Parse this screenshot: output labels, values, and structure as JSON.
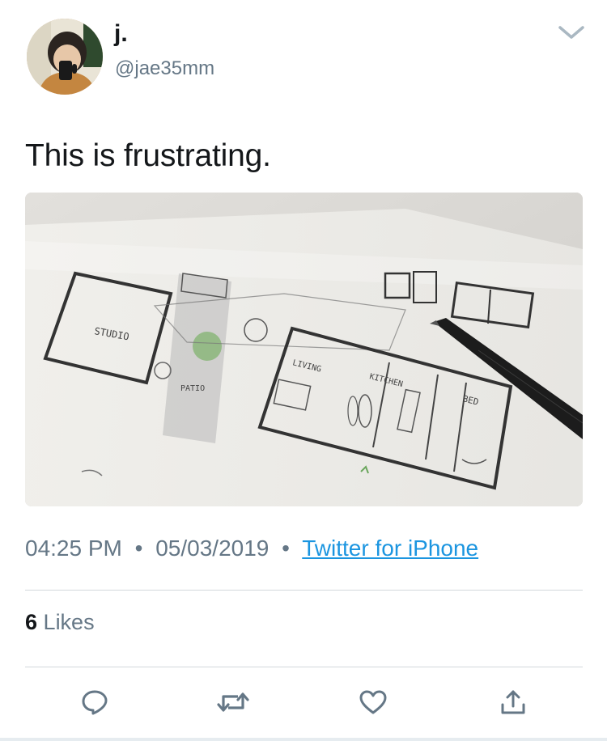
{
  "tweet": {
    "display_name": "j.",
    "handle": "@jae35mm",
    "text": "This is frustrating.",
    "time": "04:25 PM",
    "date": "05/03/2019",
    "source": "Twitter for iPhone",
    "likes_count": "6",
    "likes_label": "Likes",
    "meta_separator": "•"
  },
  "sketch_labels": {
    "studio": "STUDIO",
    "patio": "PATIO",
    "living": "LIVING",
    "kitchen": "KITCHEN",
    "bed": "BED"
  },
  "icons": {
    "menu": "chevron-down-icon",
    "reply": "reply-icon",
    "retweet": "retweet-icon",
    "like": "heart-icon",
    "share": "share-icon"
  },
  "colors": {
    "text": "#14171a",
    "secondary": "#657786",
    "link": "#1b95e0",
    "divider": "#d3d8dc"
  }
}
